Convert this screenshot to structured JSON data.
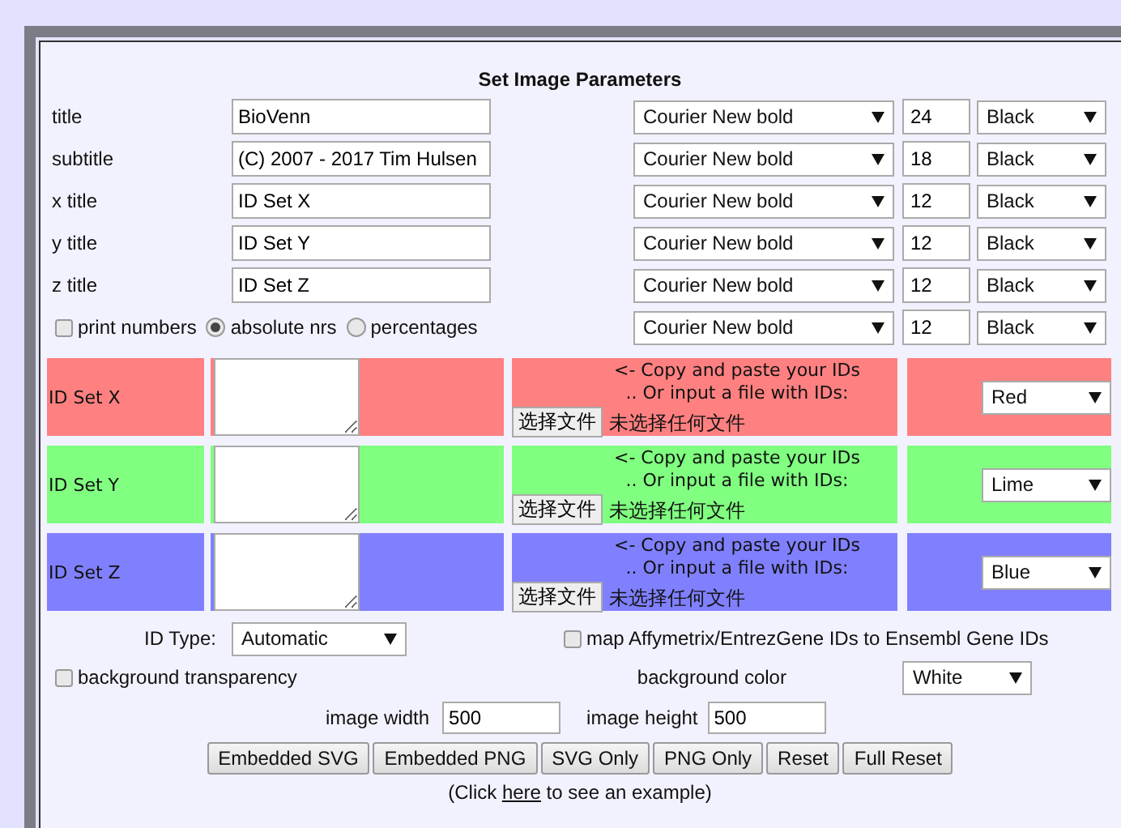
{
  "heading": "Set Image Parameters",
  "text_rows": [
    {
      "label": "title",
      "value": "BioVenn",
      "font": "Courier New bold",
      "size": "24",
      "color_choice": "Black"
    },
    {
      "label": "subtitle",
      "value": "(C) 2007 - 2017 Tim Hulsen",
      "font": "Courier New bold",
      "size": "18",
      "color_choice": "Black"
    },
    {
      "label": "x title",
      "value": "ID Set X",
      "font": "Courier New bold",
      "size": "12",
      "color_choice": "Black"
    },
    {
      "label": "y title",
      "value": "ID Set Y",
      "font": "Courier New bold",
      "size": "12",
      "color_choice": "Black"
    },
    {
      "label": "z title",
      "value": "ID Set Z",
      "font": "Courier New bold",
      "size": "12",
      "color_choice": "Black"
    }
  ],
  "number_row": {
    "print_numbers": {
      "label": "print numbers",
      "checked": false
    },
    "modes": [
      {
        "label": "absolute nrs",
        "selected": true
      },
      {
        "label": "percentages",
        "selected": false
      }
    ],
    "font": "Courier New bold",
    "size": "12",
    "color_choice": "Black"
  },
  "sets": [
    {
      "label": "ID Set X",
      "color": "#ff8080",
      "hint": "<- Copy and paste your IDs",
      "hint_2": ".. Or input a file with IDs:",
      "file_button": "选择文件",
      "file_status": "未选择任何文件",
      "color_name": "Red"
    },
    {
      "label": "ID Set Y",
      "color": "#80ff80",
      "hint": "<- Copy and paste your IDs",
      "hint_2": ".. Or input a file with IDs:",
      "file_button": "选择文件",
      "file_status": "未选择任何文件",
      "color_name": "Lime"
    },
    {
      "label": "ID Set Z",
      "color": "#8080ff",
      "hint": "<- Copy and paste your IDs",
      "hint_2": ".. Or input a file with IDs:",
      "file_button": "选择文件",
      "file_status": "未选择任何文件",
      "color_name": "Blue"
    }
  ],
  "id_type": {
    "label": "ID Type:",
    "value": "Automatic"
  },
  "map_ids": {
    "label": "map Affymetrix/EntrezGene IDs to Ensembl Gene IDs",
    "checked": false
  },
  "transparency": {
    "label": "background transparency",
    "checked": false
  },
  "background_color": {
    "label": "background color",
    "value": "White"
  },
  "image_width": {
    "label": "image width",
    "value": "500"
  },
  "image_height": {
    "label": "image height",
    "value": "500"
  },
  "buttons": [
    "Embedded SVG",
    "Embedded PNG",
    "SVG Only",
    "PNG Only",
    "Reset",
    "Full Reset"
  ],
  "note": {
    "before": "(Click ",
    "link": "here",
    "after": " to see an example)"
  }
}
